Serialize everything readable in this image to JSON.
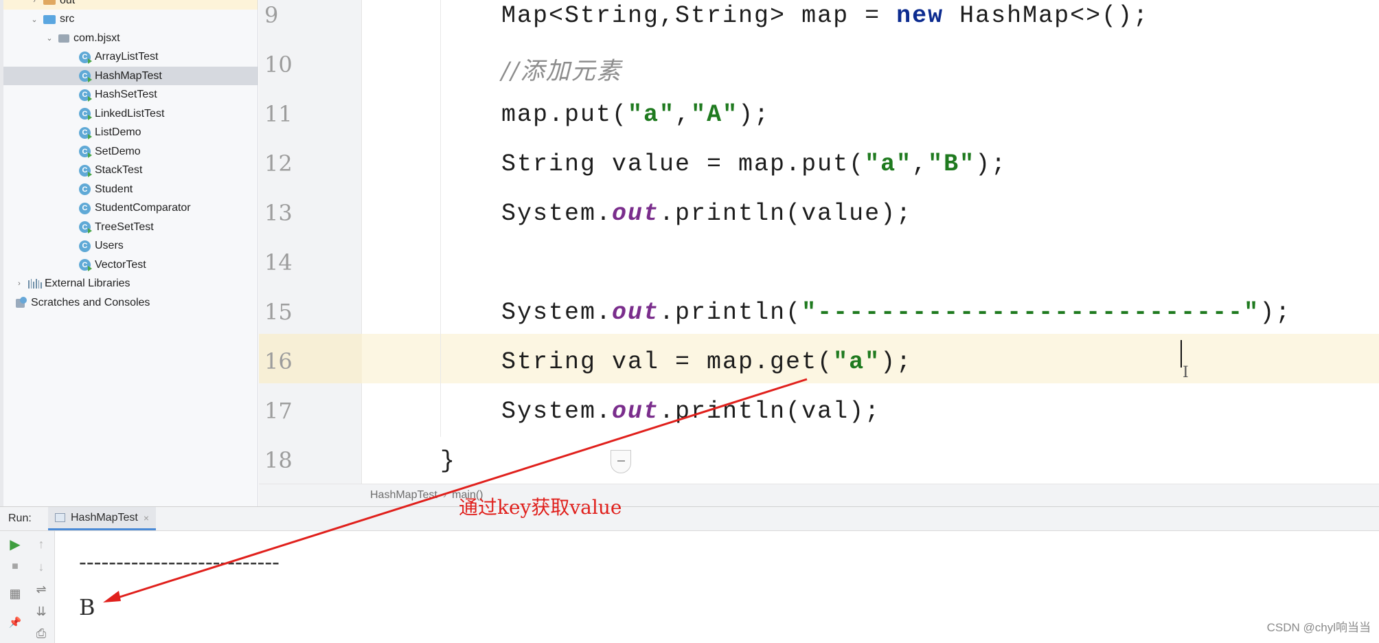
{
  "project_tree": {
    "items": [
      {
        "label": "out",
        "type": "folder-orange",
        "indent": 1,
        "chevron": "›"
      },
      {
        "label": "src",
        "type": "folder-blue",
        "indent": 1,
        "chevron": "⌄"
      },
      {
        "label": "com.bjsxt",
        "type": "package",
        "indent": 2,
        "chevron": "⌄"
      },
      {
        "label": "ArrayListTest",
        "type": "class-run",
        "indent": 3
      },
      {
        "label": "HashMapTest",
        "type": "class-run",
        "indent": 3,
        "selected": true
      },
      {
        "label": "HashSetTest",
        "type": "class-run",
        "indent": 3
      },
      {
        "label": "LinkedListTest",
        "type": "class-run",
        "indent": 3
      },
      {
        "label": "ListDemo",
        "type": "class-run",
        "indent": 3
      },
      {
        "label": "SetDemo",
        "type": "class-run",
        "indent": 3
      },
      {
        "label": "StackTest",
        "type": "class-run",
        "indent": 3
      },
      {
        "label": "Student",
        "type": "class",
        "indent": 3
      },
      {
        "label": "StudentComparator",
        "type": "class",
        "indent": 3
      },
      {
        "label": "TreeSetTest",
        "type": "class-run",
        "indent": 3
      },
      {
        "label": "Users",
        "type": "class",
        "indent": 3
      },
      {
        "label": "VectorTest",
        "type": "class-run",
        "indent": 3
      },
      {
        "label": "External Libraries",
        "type": "libraries",
        "indent": 0,
        "chevron": "›"
      },
      {
        "label": "Scratches and Consoles",
        "type": "scratches",
        "indent": 0
      }
    ],
    "class_icon_letter": "C"
  },
  "editor": {
    "lines": [
      {
        "num": "9",
        "tokens": [
          [
            "",
            "Map<String,String> map = "
          ],
          [
            "kw",
            "new"
          ],
          [
            "",
            " HashMap<>();"
          ]
        ]
      },
      {
        "num": "10",
        "tokens": [
          [
            "cmt",
            "//添加元素"
          ]
        ]
      },
      {
        "num": "11",
        "tokens": [
          [
            "",
            "map.put("
          ],
          [
            "str",
            "\"a\""
          ],
          [
            "",
            ","
          ],
          [
            "str",
            "\"A\""
          ],
          [
            "",
            ");"
          ]
        ]
      },
      {
        "num": "12",
        "tokens": [
          [
            "",
            "String value = map.put("
          ],
          [
            "str",
            "\"a\""
          ],
          [
            "",
            ","
          ],
          [
            "str",
            "\"B\""
          ],
          [
            "",
            ");"
          ]
        ]
      },
      {
        "num": "13",
        "tokens": [
          [
            "",
            "System."
          ],
          [
            "fld",
            "out"
          ],
          [
            "",
            ".println(value);"
          ]
        ]
      },
      {
        "num": "14",
        "tokens": []
      },
      {
        "num": "15",
        "tokens": [
          [
            "",
            "System."
          ],
          [
            "fld",
            "out"
          ],
          [
            "",
            ".println("
          ],
          [
            "str",
            "\"---------------------------\""
          ],
          [
            "",
            ");"
          ]
        ]
      },
      {
        "num": "16",
        "tokens": [
          [
            "",
            "String val = map.get("
          ],
          [
            "str",
            "\"a\""
          ],
          [
            "",
            ");"
          ]
        ]
      },
      {
        "num": "17",
        "tokens": [
          [
            "",
            "System."
          ],
          [
            "fld",
            "out"
          ],
          [
            "",
            ".println(val);"
          ]
        ]
      },
      {
        "num": "18",
        "tokens": [
          [
            "",
            "}"
          ]
        ]
      }
    ],
    "breadcrumb": [
      "HashMapTest",
      "main()"
    ],
    "breadcrumb_sep": "›"
  },
  "run_panel": {
    "label": "Run:",
    "tab_label": "HashMapTest",
    "tab_close": "×",
    "console_lines": [
      "---------------------------",
      "B"
    ],
    "tools": {
      "play": "▶",
      "stop": "■",
      "up": "↑",
      "down": "↓",
      "wrap": "⇌",
      "layout": "▦",
      "scroll_end": "⇊",
      "pin": "📌",
      "print": "⎙"
    }
  },
  "annotation": {
    "text": "通过key获取value",
    "color": "#e0201c"
  },
  "watermark": "CSDN @chyl响当当",
  "colors": {
    "keyword": "#0c2b8f",
    "string": "#1f7a1f",
    "field": "#7a2d8c",
    "comment": "#8c8c8c",
    "current_line": "#fcf6e2"
  }
}
